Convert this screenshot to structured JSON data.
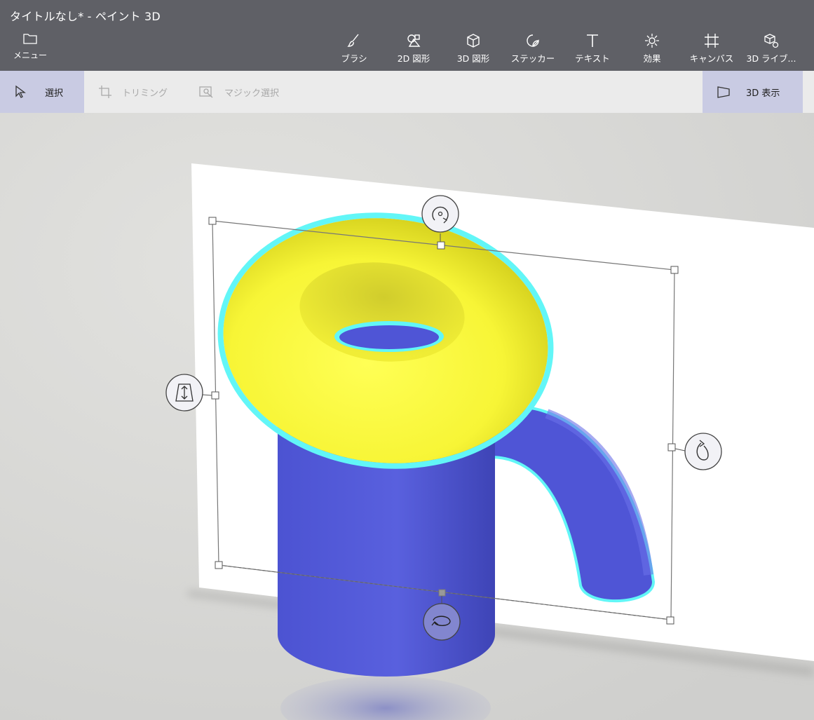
{
  "window": {
    "title": "タイトルなし* - ペイント 3D"
  },
  "menu": {
    "label": "メニュー",
    "icon": "folder-icon"
  },
  "toolbar": {
    "items": [
      {
        "label": "ブラシ",
        "icon": "brush-icon"
      },
      {
        "label": "2D 図形",
        "icon": "2d-shapes-icon"
      },
      {
        "label": "3D 図形",
        "icon": "3d-shapes-icon"
      },
      {
        "label": "ステッカー",
        "icon": "sticker-icon"
      },
      {
        "label": "テキスト",
        "icon": "text-icon"
      },
      {
        "label": "効果",
        "icon": "effects-icon"
      },
      {
        "label": "キャンバス",
        "icon": "canvas-icon"
      },
      {
        "label": "3D ライブ...",
        "icon": "3d-library-icon"
      }
    ]
  },
  "subtoolbar": {
    "select": "選択",
    "crop": "トリミング",
    "magic_select": "マジック選択",
    "view_3d": "3D 表示"
  },
  "colors": {
    "titlebar": "#5f6066",
    "subbar": "#ebebeb",
    "selected_tab": "#c9cbe3",
    "torus": "#f7f536",
    "cylinder": "#4f55d6",
    "selection_glow": "#62f6f7"
  }
}
